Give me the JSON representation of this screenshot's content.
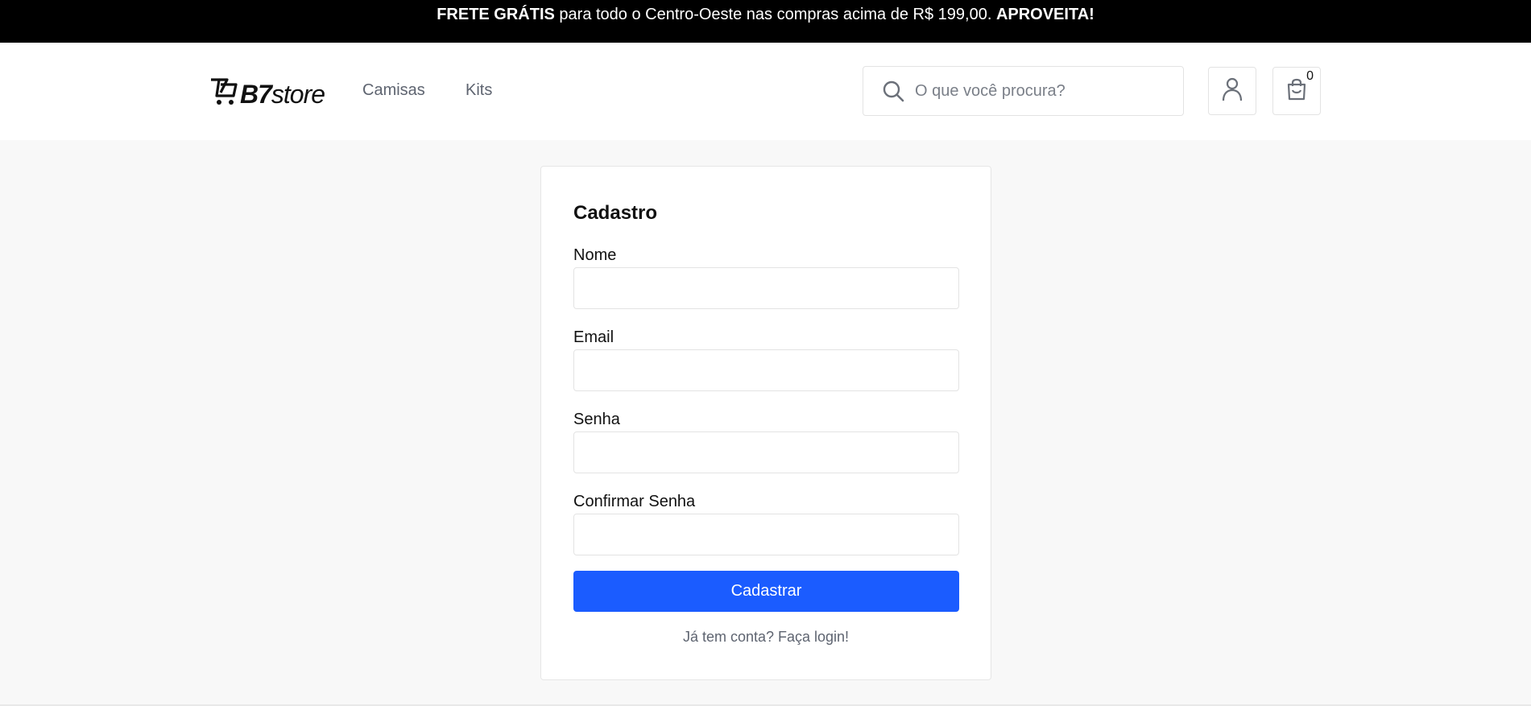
{
  "promo": {
    "lead_bold": "FRETE GRÁTIS",
    "text": " para todo o Centro-Oeste nas compras acima de R$ 199,00. ",
    "cta_bold": "APROVEITA!"
  },
  "header": {
    "logo": {
      "bold": "B7",
      "rest": "store"
    },
    "nav": [
      {
        "label": "Camisas"
      },
      {
        "label": "Kits"
      }
    ],
    "search": {
      "placeholder": "O que você procura?",
      "value": ""
    },
    "cart_count": "0",
    "icons": [
      "search-icon",
      "user-icon",
      "cart-bag-icon",
      "cart-logo-icon"
    ]
  },
  "form": {
    "title": "Cadastro",
    "fields": [
      {
        "label": "Nome",
        "value": ""
      },
      {
        "label": "Email",
        "value": ""
      },
      {
        "label": "Senha",
        "value": ""
      },
      {
        "label": "Confirmar Senha",
        "value": ""
      }
    ],
    "submit_label": "Cadastrar",
    "login_link": "Já tem conta? Faça login!"
  },
  "colors": {
    "promo_bg": "#000000",
    "primary": "#1b5cff",
    "page_bg": "#f8f8f8",
    "muted_text": "#5e6470"
  }
}
